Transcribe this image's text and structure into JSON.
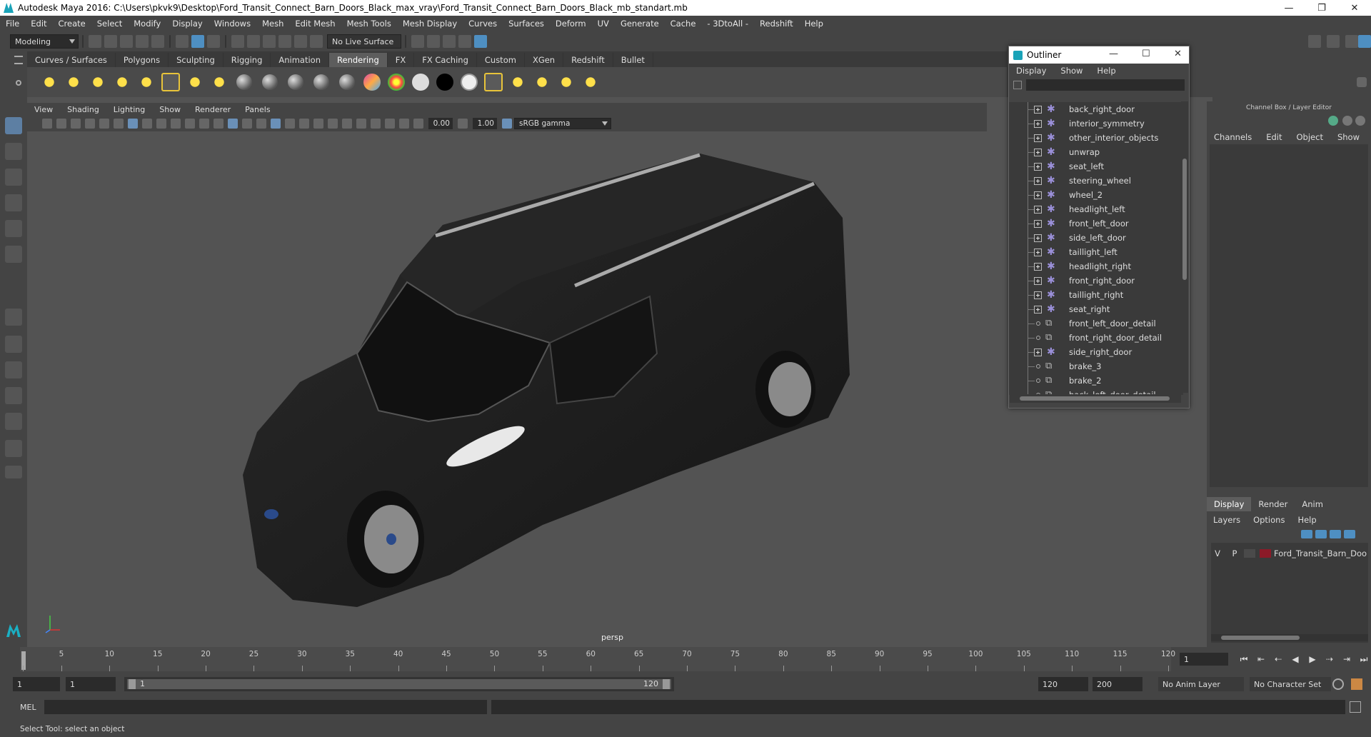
{
  "window": {
    "title": "Autodesk Maya 2016: C:\\Users\\pkvk9\\Desktop\\Ford_Transit_Connect_Barn_Doors_Black_max_vray\\Ford_Transit_Connect_Barn_Doors_Black_mb_standart.mb"
  },
  "menubar": [
    "File",
    "Edit",
    "Create",
    "Select",
    "Modify",
    "Display",
    "Windows",
    "Mesh",
    "Edit Mesh",
    "Mesh Tools",
    "Mesh Display",
    "Curves",
    "Surfaces",
    "Deform",
    "UV",
    "Generate",
    "Cache",
    "- 3DtoAll -",
    "Redshift",
    "Help"
  ],
  "toolbar": {
    "mode": "Modeling",
    "live_surface": "No Live Surface"
  },
  "shelf_tabs": [
    "Curves / Surfaces",
    "Polygons",
    "Sculpting",
    "Rigging",
    "Animation",
    "Rendering",
    "FX",
    "FX Caching",
    "Custom",
    "XGen",
    "Redshift",
    "Bullet"
  ],
  "shelf_active": "Rendering",
  "viewport": {
    "menu": [
      "View",
      "Shading",
      "Lighting",
      "Show",
      "Renderer",
      "Panels"
    ],
    "exposure": "0.00",
    "gamma": "1.00",
    "color_space": "sRGB gamma",
    "camera_label": "persp"
  },
  "outliner": {
    "title": "Outliner",
    "menu": [
      "Display",
      "Show",
      "Help"
    ],
    "items": [
      {
        "label": "back_right_door",
        "kind": "group"
      },
      {
        "label": "interior_symmetry",
        "kind": "group"
      },
      {
        "label": "other_interior_objects",
        "kind": "group"
      },
      {
        "label": "unwrap",
        "kind": "group"
      },
      {
        "label": "seat_left",
        "kind": "group"
      },
      {
        "label": "steering_wheel",
        "kind": "group"
      },
      {
        "label": "wheel_2",
        "kind": "group"
      },
      {
        "label": "headlight_left",
        "kind": "group"
      },
      {
        "label": "front_left_door",
        "kind": "group"
      },
      {
        "label": "side_left_door",
        "kind": "group"
      },
      {
        "label": "taillight_left",
        "kind": "group"
      },
      {
        "label": "headlight_right",
        "kind": "group"
      },
      {
        "label": "front_right_door",
        "kind": "group"
      },
      {
        "label": "taillight_right",
        "kind": "group"
      },
      {
        "label": "seat_right",
        "kind": "group"
      },
      {
        "label": "front_left_door_detail",
        "kind": "mesh"
      },
      {
        "label": "front_right_door_detail",
        "kind": "mesh"
      },
      {
        "label": "side_right_door",
        "kind": "group"
      },
      {
        "label": "brake_3",
        "kind": "mesh"
      },
      {
        "label": "brake_2",
        "kind": "mesh"
      },
      {
        "label": "back_left_door_detail",
        "kind": "mesh"
      }
    ]
  },
  "channel_box": {
    "header": "Channel Box / Layer Editor",
    "menu": [
      "Channels",
      "Edit",
      "Object",
      "Show"
    ]
  },
  "layer_editor": {
    "tabs": [
      "Display",
      "Render",
      "Anim"
    ],
    "active_tab": "Display",
    "menu": [
      "Layers",
      "Options",
      "Help"
    ],
    "layers": [
      {
        "v": "V",
        "p": "P",
        "name": "Ford_Transit_Barn_Doors",
        "color": "#8b1a28"
      }
    ]
  },
  "timeline": {
    "ticks": [
      1,
      5,
      10,
      15,
      20,
      25,
      30,
      35,
      40,
      45,
      50,
      55,
      60,
      65,
      70,
      75,
      80,
      85,
      90,
      95,
      100,
      105,
      110,
      115,
      120
    ],
    "current_frame": "1"
  },
  "range": {
    "start": "1",
    "start2": "1",
    "slider_start": "1",
    "slider_end": "120",
    "end": "120",
    "end2": "200",
    "anim_layer": "No Anim Layer",
    "char_set": "No Character Set"
  },
  "command": {
    "lang": "MEL"
  },
  "status": "Select Tool: select an object"
}
